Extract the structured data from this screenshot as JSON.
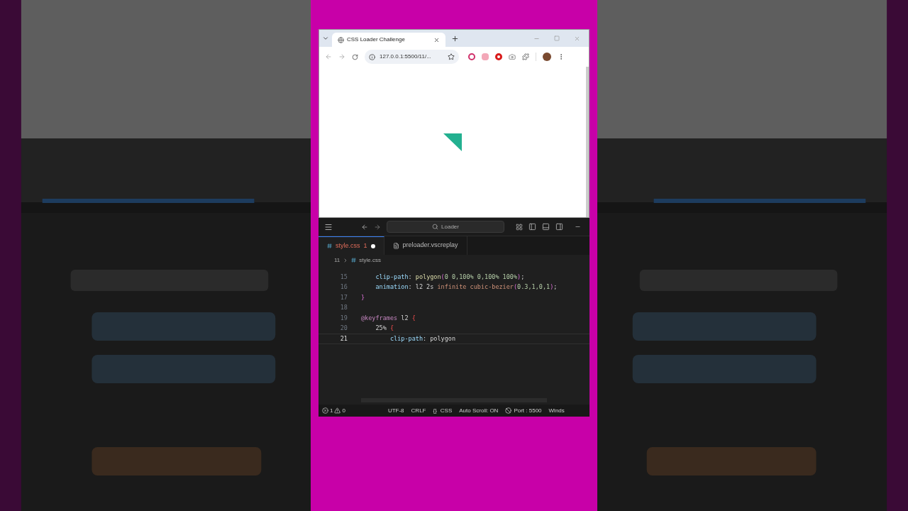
{
  "browser": {
    "tab_title": "CSS Loader Challenge",
    "url": "127.0.0.1:5500/11/..."
  },
  "editor": {
    "command_center": "Loader",
    "tabs": [
      {
        "label": "style.css",
        "problems": "1",
        "modified": true,
        "selected": true,
        "kind": "css"
      },
      {
        "label": "preloader.vscreplay",
        "modified": false,
        "selected": false,
        "kind": "file"
      }
    ],
    "breadcrumb": {
      "folder": "11",
      "file": "style.css"
    },
    "lines": [
      {
        "number": "15",
        "current": false,
        "segments": [
          {
            "text": "    clip-path",
            "kind": "prop"
          },
          {
            "text": ": ",
            "kind": "plain"
          },
          {
            "text": "polygon",
            "kind": "func"
          },
          {
            "text": "(",
            "kind": "brace"
          },
          {
            "text": "0 0,100% 0,100% 100%",
            "kind": "num"
          },
          {
            "text": ")",
            "kind": "brace"
          },
          {
            "text": ";",
            "kind": "plain"
          }
        ]
      },
      {
        "number": "16",
        "current": false,
        "segments": [
          {
            "text": "    animation",
            "kind": "prop"
          },
          {
            "text": ": l2 2s ",
            "kind": "plain"
          },
          {
            "text": "infinite",
            "kind": "value"
          },
          {
            "text": " cubic-bezier",
            "kind": "value"
          },
          {
            "text": "(",
            "kind": "brace"
          },
          {
            "text": "0.3,1,0,1",
            "kind": "num"
          },
          {
            "text": ")",
            "kind": "brace"
          },
          {
            "text": ";",
            "kind": "plain"
          }
        ]
      },
      {
        "number": "17",
        "current": false,
        "segments": [
          {
            "text": "}",
            "kind": "brace"
          }
        ]
      },
      {
        "number": "18",
        "current": false
      },
      {
        "number": "19",
        "current": false,
        "segments": [
          {
            "text": "@keyframes",
            "kind": "at"
          },
          {
            "text": " l2 ",
            "kind": "plain"
          },
          {
            "text": "{",
            "kind": "brace2"
          }
        ]
      },
      {
        "number": "20",
        "current": false,
        "segments": [
          {
            "text": "    25%",
            "kind": "plain"
          },
          {
            "text": " {",
            "kind": "brace2"
          }
        ]
      },
      {
        "number": "21",
        "current": true,
        "segments": [
          {
            "text": "        clip-path",
            "kind": "prop"
          },
          {
            "text": ": polygon",
            "kind": "plain"
          }
        ]
      }
    ],
    "status": {
      "errors": "1",
      "warnings": "0",
      "items": [
        "UTF-8",
        "CRLF"
      ],
      "language_icon": "{}",
      "language": "CSS",
      "auto_scroll": "Auto Scroll: ON",
      "port": "Port : 5500",
      "last": "Winds"
    }
  }
}
